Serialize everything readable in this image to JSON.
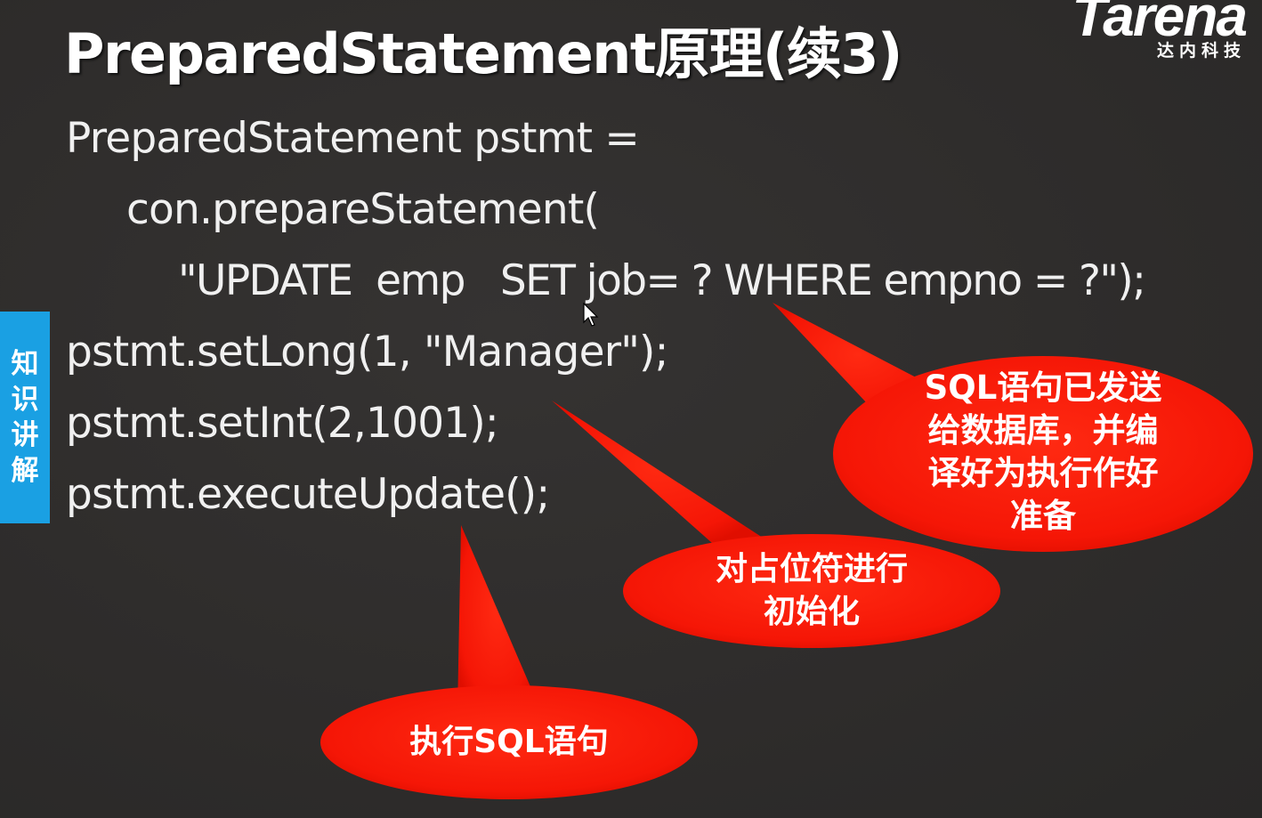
{
  "slide": {
    "title": "PreparedStatement原理(续3)",
    "logo": {
      "word": "Tarena",
      "subtitle": "达内科技"
    },
    "side_tab": {
      "chars": [
        "知",
        "识",
        "讲",
        "解"
      ]
    },
    "code": {
      "line1": "PreparedStatement pstmt =",
      "line2": "con.prepareStatement(",
      "line3": "\"UPDATE  emp   SET job= ? WHERE empno = ?\");",
      "line4": "pstmt.setLong(1, \"Manager\");",
      "line5": "pstmt.setInt(2,1001);",
      "line6": "pstmt.executeUpdate();"
    },
    "callouts": {
      "sql_sent": [
        "SQL语句已发送",
        "给数据库，并编",
        "译好为执行作好",
        "准备"
      ],
      "init_placeholder": [
        "对占位符进行",
        "初始化"
      ],
      "execute_sql": [
        "执行SQL语句"
      ]
    },
    "colors": {
      "background": "#2f2d2c",
      "callout": "#ff1a0a",
      "side_tab": "#1aa0e3",
      "text": "#ffffff"
    }
  }
}
